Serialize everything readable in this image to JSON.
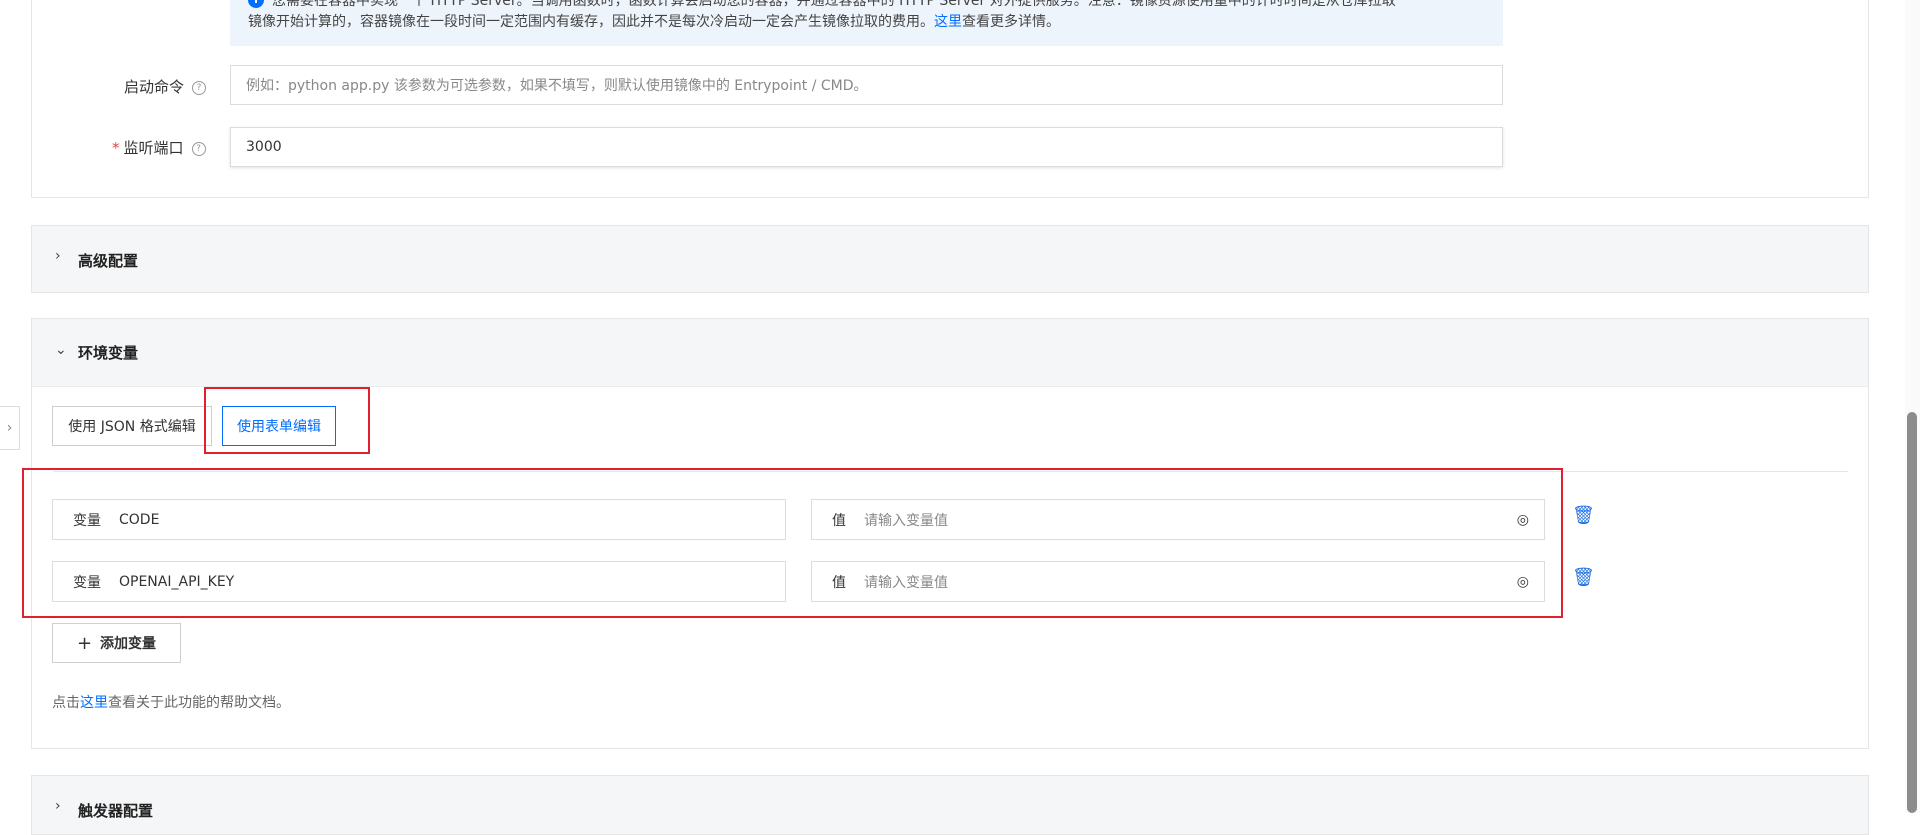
{
  "notice": {
    "line1": "您需要在容器中实现一个 HTTP Server。当调用函数时，函数计算会启动您的容器，并通过容器中的 HTTP Server 对外提供服务。注意：镜像资源使用量中的计时时间是从仓库拉取",
    "line2_a": "镜像开始计算的，容器镜像在一段时间一定范围内有缓存，因此并不是每次冷启动一定会产生镜像拉取的费用。",
    "line2_link": "这里",
    "line2_b": "查看更多详情。"
  },
  "startup": {
    "label": "启动命令",
    "placeholder": "例如：python app.py 该参数为可选参数，如果不填写，则默认使用镜像中的 Entrypoint / CMD。"
  },
  "port": {
    "required_mark": "*",
    "label": "监听端口",
    "value": "3000"
  },
  "advanced": {
    "title": "高级配置"
  },
  "env": {
    "title": "环境变量",
    "json_button": "使用 JSON 格式编辑",
    "form_button": "使用表单编辑",
    "key_prefix": "变量",
    "value_prefix": "值",
    "rows": [
      {
        "key": "CODE",
        "value_placeholder": "请输入变量值"
      },
      {
        "key": "OPENAI_API_KEY",
        "value_placeholder": "请输入变量值"
      }
    ],
    "add_button": "添加变量",
    "help_a": "点击",
    "help_link": "这里",
    "help_b": "查看关于此功能的帮助文档。"
  },
  "trigger": {
    "title": "触发器配置"
  },
  "colors": {
    "accent": "#006eff",
    "highlight": "#e0202e"
  }
}
